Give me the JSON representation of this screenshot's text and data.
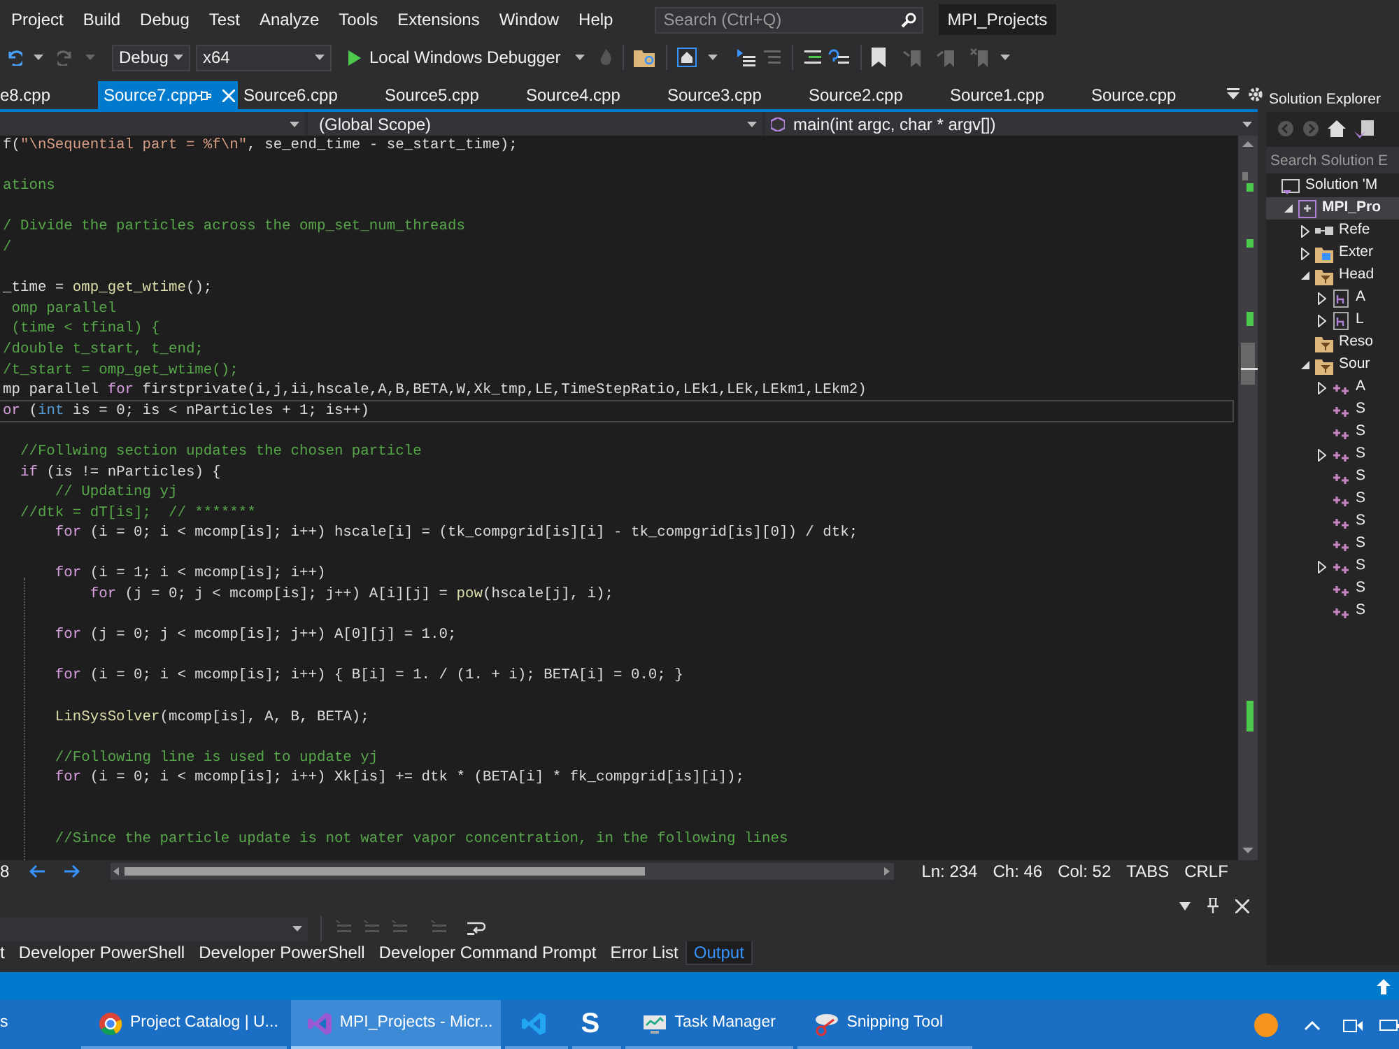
{
  "menu": [
    "Project",
    "Build",
    "Debug",
    "Test",
    "Analyze",
    "Tools",
    "Extensions",
    "Window",
    "Help"
  ],
  "search": {
    "placeholder": "Search (Ctrl+Q)"
  },
  "solution_name": "MPI_Projects",
  "toolbar": {
    "configuration": "Debug",
    "platform": "x64",
    "start": "Local Windows Debugger"
  },
  "tabs": [
    {
      "label": "e8.cpp",
      "selected": false
    },
    {
      "label": "Source7.cpp",
      "selected": true
    },
    {
      "label": "Source6.cpp",
      "selected": false
    },
    {
      "label": "Source5.cpp",
      "selected": false
    },
    {
      "label": "Source4.cpp",
      "selected": false
    },
    {
      "label": "Source3.cpp",
      "selected": false
    },
    {
      "label": "Source2.cpp",
      "selected": false
    },
    {
      "label": "Source1.cpp",
      "selected": false
    },
    {
      "label": "Source.cpp",
      "selected": false
    }
  ],
  "navigation": {
    "scope": "(Global Scope)",
    "member": "main(int argc, char * argv[])"
  },
  "code": {
    "lines": [
      {
        "current": false,
        "tokens": [
          {
            "text": "f(",
            "kind": "plain"
          },
          {
            "text": "\"\\nSequential part = %f\\n\"",
            "kind": "string"
          },
          {
            "text": ", se_end_time - se_start_time);",
            "kind": "plain"
          }
        ]
      },
      {
        "current": false
      },
      {
        "current": false,
        "tokens": [
          {
            "text": "ations",
            "kind": "comment"
          }
        ]
      },
      {
        "current": false
      },
      {
        "current": false,
        "tokens": [
          {
            "text": "/ Divide the particles across the omp_set_num_threads",
            "kind": "comment"
          }
        ]
      },
      {
        "current": false,
        "tokens": [
          {
            "text": "/",
            "kind": "comment"
          }
        ]
      },
      {
        "current": false
      },
      {
        "current": false,
        "tokens": [
          {
            "text": "_time = ",
            "kind": "plain"
          },
          {
            "text": "omp_get_wtime",
            "kind": "function"
          },
          {
            "text": "();",
            "kind": "plain"
          }
        ]
      },
      {
        "current": false,
        "tokens": [
          {
            "text": " omp parallel",
            "kind": "comment"
          }
        ]
      },
      {
        "current": false,
        "tokens": [
          {
            "text": " (time < tfinal) {",
            "kind": "comment"
          }
        ]
      },
      {
        "current": false,
        "tokens": [
          {
            "text": "/double t_start, t_end;",
            "kind": "comment"
          }
        ]
      },
      {
        "current": false,
        "tokens": [
          {
            "text": "/t_start = omp_get_wtime();",
            "kind": "comment"
          }
        ]
      },
      {
        "current": false,
        "tokens": [
          {
            "text": "mp parallel ",
            "kind": "plain"
          },
          {
            "text": "for",
            "kind": "keyword"
          },
          {
            "text": " firstprivate(i,j,ii,hscale,A,B,BETA,W,Xk_tmp,LE,TimeStepRatio,LEk1,LEk,LEkm1,LEkm2)",
            "kind": "plain"
          }
        ]
      },
      {
        "current": true,
        "tokens": [
          {
            "text": "or",
            "kind": "keyword"
          },
          {
            "text": " (",
            "kind": "plain"
          },
          {
            "text": "int",
            "kind": "type"
          },
          {
            "text": " is = 0; is < nParticles + 1; is++)",
            "kind": "plain"
          }
        ]
      },
      {
        "current": false
      },
      {
        "current": false,
        "tokens": [
          {
            "text": "  //Follwing section updates the chosen particle",
            "kind": "comment"
          }
        ]
      },
      {
        "current": false,
        "tokens": [
          {
            "text": "  if",
            "kind": "keyword"
          },
          {
            "text": " (is != nParticles) {",
            "kind": "plain"
          }
        ]
      },
      {
        "current": false,
        "tokens": [
          {
            "text": "      // Updating yj",
            "kind": "comment"
          }
        ]
      },
      {
        "current": false,
        "tokens": [
          {
            "text": "  //dtk = dT[is];  // *******",
            "kind": "comment"
          }
        ]
      },
      {
        "current": false,
        "tokens": [
          {
            "text": "      for",
            "kind": "keyword"
          },
          {
            "text": " (i = 0; i < mcomp[is]; i++) hscale[i] = (tk_compgrid[is][i] - tk_compgrid[is][0]) / dtk;",
            "kind": "plain"
          }
        ]
      },
      {
        "current": false
      },
      {
        "current": false,
        "tokens": [
          {
            "text": "      for",
            "kind": "keyword"
          },
          {
            "text": " (i = 1; i < mcomp[is]; i++)",
            "kind": "plain"
          }
        ]
      },
      {
        "current": false,
        "tokens": [
          {
            "text": "          for",
            "kind": "keyword"
          },
          {
            "text": " (j = 0; j < mcomp[is]; j++) A[i][j] = ",
            "kind": "plain"
          },
          {
            "text": "pow",
            "kind": "function"
          },
          {
            "text": "(hscale[j], i);",
            "kind": "plain"
          }
        ]
      },
      {
        "current": false
      },
      {
        "current": false,
        "tokens": [
          {
            "text": "      for",
            "kind": "keyword"
          },
          {
            "text": " (j = 0; j < mcomp[is]; j++) A[0][j] = 1.0;",
            "kind": "plain"
          }
        ]
      },
      {
        "current": false
      },
      {
        "current": false,
        "tokens": [
          {
            "text": "      for",
            "kind": "keyword"
          },
          {
            "text": " (i = 0; i < mcomp[is]; i++) { B[i] = 1. / (1. + i); BETA[i] = 0.0; }",
            "kind": "plain"
          }
        ]
      },
      {
        "current": false
      },
      {
        "current": false,
        "tokens": [
          {
            "text": "      LinSysSolver",
            "kind": "function"
          },
          {
            "text": "(mcomp[is], A, B, BETA);",
            "kind": "plain"
          }
        ]
      },
      {
        "current": false
      },
      {
        "current": false,
        "tokens": [
          {
            "text": "      //Following line is used to update yj",
            "kind": "comment"
          }
        ]
      },
      {
        "current": false,
        "tokens": [
          {
            "text": "      for",
            "kind": "keyword"
          },
          {
            "text": " (i = 0; i < mcomp[is]; i++) Xk[is] += dtk * (BETA[i] * fk_compgrid[is][i]);",
            "kind": "plain"
          }
        ]
      },
      {
        "current": false
      },
      {
        "current": false
      },
      {
        "current": false,
        "tokens": [
          {
            "text": "      //Since the particle update is not water vapor concentration, in the following lines",
            "kind": "comment"
          }
        ]
      }
    ]
  },
  "editor_status": {
    "zoom": "8",
    "line": "Ln: 234",
    "char": "Ch: 46",
    "column": "Col: 52",
    "indent": "TABS",
    "eol": "CRLF"
  },
  "panel_tabs": [
    {
      "label": "t",
      "selected": false
    },
    {
      "label": "Developer PowerShell",
      "selected": false
    },
    {
      "label": "Developer PowerShell",
      "selected": false
    },
    {
      "label": "Developer Command Prompt",
      "selected": false
    },
    {
      "label": "Error List",
      "selected": false
    },
    {
      "label": "Output",
      "selected": true
    }
  ],
  "solution_explorer": {
    "title": "Solution Explorer",
    "search_placeholder": "Search Solution E",
    "tree": [
      {
        "label": "Solution 'M",
        "kind": "solution",
        "selected": false,
        "children": [
          {
            "label": "MPI_Pro",
            "kind": "project",
            "expanded": true,
            "selected": true,
            "children": [
              {
                "label": "Refe",
                "kind": "references",
                "expanded": false,
                "selected": false
              },
              {
                "label": "Exter",
                "kind": "external",
                "expanded": false,
                "selected": false
              },
              {
                "label": "Head",
                "kind": "filter",
                "expanded": true,
                "selected": false,
                "children": [
                  {
                    "label": "A",
                    "kind": "header",
                    "expanded": false,
                    "selected": false
                  },
                  {
                    "label": "L",
                    "kind": "header",
                    "expanded": false,
                    "selected": false
                  }
                ]
              },
              {
                "label": "Reso",
                "kind": "filter",
                "selected": false
              },
              {
                "label": "Sour",
                "kind": "filter",
                "expanded": true,
                "selected": false,
                "children": [
                  {
                    "label": "A",
                    "kind": "cpp",
                    "expanded": false,
                    "selected": false
                  },
                  {
                    "label": "S",
                    "kind": "cpp",
                    "selected": false
                  },
                  {
                    "label": "S",
                    "kind": "cpp",
                    "selected": false
                  },
                  {
                    "label": "S",
                    "kind": "cpp",
                    "expanded": false,
                    "selected": false
                  },
                  {
                    "label": "S",
                    "kind": "cpp",
                    "selected": false
                  },
                  {
                    "label": "S",
                    "kind": "cpp",
                    "selected": false
                  },
                  {
                    "label": "S",
                    "kind": "cpp",
                    "selected": false
                  },
                  {
                    "label": "S",
                    "kind": "cpp",
                    "selected": false
                  },
                  {
                    "label": "S",
                    "kind": "cpp",
                    "expanded": false,
                    "selected": false
                  },
                  {
                    "label": "S",
                    "kind": "cpp",
                    "selected": false
                  },
                  {
                    "label": "S",
                    "kind": "cpp",
                    "selected": false
                  }
                ]
              }
            ]
          }
        ]
      }
    ]
  },
  "taskbar": [
    {
      "label": "s",
      "kind": "text",
      "selected": false
    },
    {
      "label": "Project Catalog | U...",
      "kind": "browser",
      "selected": false
    },
    {
      "label": "MPI_Projects - Micr...",
      "kind": "ide",
      "selected": true
    },
    {
      "kind": "editor",
      "selected": false
    },
    {
      "kind": "glyph",
      "glyph": "S",
      "selected": false
    },
    {
      "label": "Task Manager",
      "kind": "monitor",
      "selected": false
    },
    {
      "label": "Snipping Tool",
      "kind": "scissors",
      "selected": false
    }
  ]
}
